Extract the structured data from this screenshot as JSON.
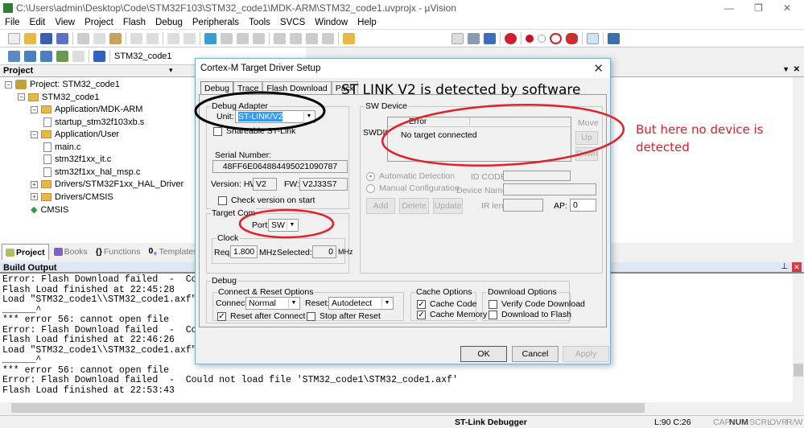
{
  "window": {
    "title": "C:\\Users\\admin\\Desktop\\Code\\STM32F103\\STM32_code1\\MDK-ARM\\STM32_code1.uvprojx - µVision"
  },
  "menu": [
    "File",
    "Edit",
    "View",
    "Project",
    "Flash",
    "Debug",
    "Peripherals",
    "Tools",
    "SVCS",
    "Window",
    "Help"
  ],
  "toolbar2": {
    "target": "STM32_code1"
  },
  "project": {
    "header": "Project",
    "tree": [
      {
        "label": "Project: STM32_code1",
        "level": 0,
        "kind": "project"
      },
      {
        "label": "STM32_code1",
        "level": 1,
        "kind": "folder"
      },
      {
        "label": "Application/MDK-ARM",
        "level": 2,
        "kind": "folder"
      },
      {
        "label": "startup_stm32f103xb.s",
        "level": 3,
        "kind": "file"
      },
      {
        "label": "Application/User",
        "level": 2,
        "kind": "folder"
      },
      {
        "label": "main.c",
        "level": 3,
        "kind": "file"
      },
      {
        "label": "stm32f1xx_it.c",
        "level": 3,
        "kind": "file"
      },
      {
        "label": "stm32f1xx_hal_msp.c",
        "level": 3,
        "kind": "file"
      },
      {
        "label": "Drivers/STM32F1xx_HAL_Driver",
        "level": 2,
        "kind": "folder"
      },
      {
        "label": "Drivers/CMSIS",
        "level": 2,
        "kind": "folder"
      },
      {
        "label": "CMSIS",
        "level": 2,
        "kind": "component"
      }
    ]
  },
  "panel_tabs": [
    "Project",
    "Books",
    "Functions",
    "Templates"
  ],
  "build": {
    "header": "Build Output",
    "lines": [
      "Error: Flash Download failed  -  Could",
      "Flash Load finished at 22:45:28",
      "Load \"STM32_code1\\\\STM32_code1.axf\"",
      "______^",
      "*** error 56: cannot open file",
      "Error: Flash Download failed  -  Could",
      "Flash Load finished at 22:46:26",
      "Load \"STM32_code1\\\\STM32_code1.axf\"",
      "______^",
      "*** error 56: cannot open file",
      "Error: Flash Download failed  -  Could not load file 'STM32_code1\\STM32_code1.axf'",
      "Flash Load finished at 22:53:43"
    ]
  },
  "status": {
    "debugger": "ST-Link Debugger",
    "pos": "L:90 C:26",
    "cap": "CAP",
    "num": "NUM",
    "scrl": "SCRL",
    "ovr": "OVR",
    "rw": "R/W"
  },
  "dialog": {
    "title": "Cortex-M Target Driver Setup",
    "tabs": [
      "Debug",
      "Trace",
      "Flash Download",
      "Pack"
    ],
    "debug_adapter": {
      "label": "Debug Adapter",
      "unit_label": "Unit:",
      "unit": "ST-LINK/V2",
      "shareable": "Shareable ST-Link",
      "shareable_checked": false,
      "serial_label": "Serial Number:",
      "serial": "48FF6E064884495021090787",
      "hw_label": "Version: HW:",
      "hw": "V2",
      "fw_label": "FW:",
      "fw": "V2J33S7",
      "check_version": "Check version on start",
      "check_version_checked": false
    },
    "target_com": {
      "label": "Target Com",
      "port_label": "Port:",
      "port": "SW",
      "clock_label": "Clock",
      "req_label": "Req:",
      "req": "1.800",
      "mhz": "MHz",
      "selected_label": "Selected:",
      "selected": "0"
    },
    "sw_device": {
      "label": "SW Device",
      "swdio": "SWDIO",
      "col_error": "Error",
      "message": "No target connected",
      "move": "Move",
      "up": "Up",
      "down": "Down",
      "auto": "Automatic Detection",
      "manual": "Manual Configuration",
      "id_code": "ID CODE:",
      "device_name": "Device Name:",
      "add": "Add",
      "delete": "Delete",
      "update": "Update",
      "ir_len": "IR len:",
      "ap_label": "AP:",
      "ap": "0"
    },
    "debug": {
      "label": "Debug",
      "connect_reset": "Connect & Reset Options",
      "connect_label": "Connect:",
      "connect": "Normal",
      "reset_label": "Reset:",
      "reset": "Autodetect",
      "reset_after": "Reset after Connect",
      "reset_after_checked": true,
      "stop_after": "Stop after Reset",
      "stop_after_checked": false,
      "cache": "Cache Options",
      "cache_code": "Cache Code",
      "cache_code_checked": true,
      "cache_memory": "Cache Memory",
      "cache_memory_checked": true,
      "download": "Download Options",
      "verify": "Verify Code Download",
      "verify_checked": false,
      "download_flash": "Download to Flash",
      "download_flash_checked": false
    },
    "buttons": {
      "ok": "OK",
      "cancel": "Cancel",
      "apply": "Apply"
    }
  },
  "annotations": {
    "detected": "ST LINK V2 is detected by software",
    "no_device": "But here no device is detected",
    "ellipse_black": "#000000",
    "ellipse_red": "#e0202a"
  }
}
